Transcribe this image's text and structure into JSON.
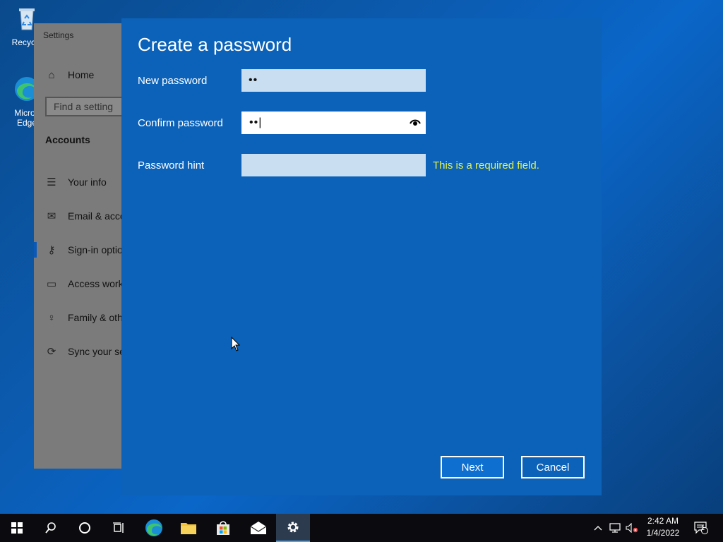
{
  "desktop": {
    "icons": [
      {
        "label": "Recycle"
      },
      {
        "label": "Micros Edge"
      }
    ]
  },
  "settings": {
    "title": "Settings",
    "home": "Home",
    "search_placeholder": "Find a setting",
    "section": "Accounts",
    "items": [
      {
        "label": "Your info"
      },
      {
        "label": "Email & acco"
      },
      {
        "label": "Sign-in optio"
      },
      {
        "label": "Access work"
      },
      {
        "label": "Family & oth"
      },
      {
        "label": "Sync your se"
      }
    ],
    "selected_index": 2
  },
  "dialog": {
    "title": "Create a password",
    "new_password": {
      "label": "New password",
      "value": "••"
    },
    "confirm_password": {
      "label": "Confirm password",
      "value": "••|"
    },
    "password_hint": {
      "label": "Password hint",
      "value": "",
      "error": "This is a required field."
    },
    "next_label": "Next",
    "cancel_label": "Cancel"
  },
  "taskbar": {
    "clock_time": "2:42 AM",
    "clock_date": "1/4/2022",
    "notification_count": "1",
    "accent": "#4aa3f0"
  }
}
